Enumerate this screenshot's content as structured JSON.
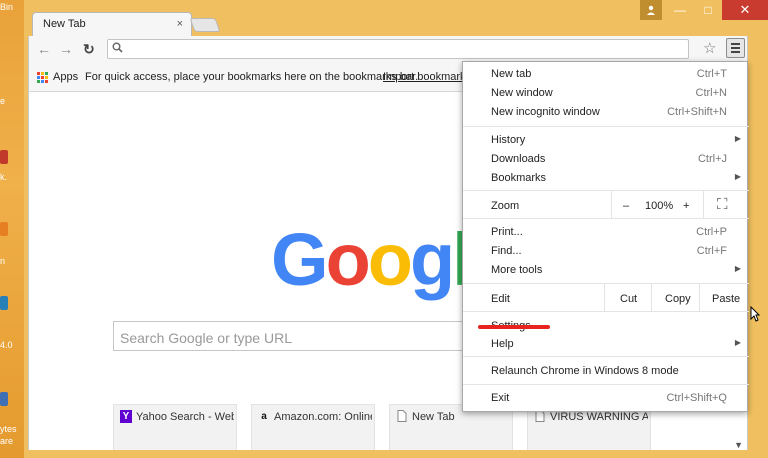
{
  "desktop": {
    "labels": [
      "Bin",
      "e",
      "k.",
      "n",
      "4.0",
      "ytes",
      "are"
    ]
  },
  "window": {
    "close_glyph": "✕",
    "maximize_glyph": "□",
    "minimize_glyph": "—"
  },
  "tab": {
    "title": "New Tab",
    "close_glyph": "×"
  },
  "toolbar": {
    "back_glyph": "←",
    "forward_glyph": "→",
    "reload_glyph": "↻",
    "search_icon": "search-icon",
    "star_glyph": "☆",
    "omnibox_value": ""
  },
  "bookmarks": {
    "apps_label": "Apps",
    "hint": "For quick access, place your bookmarks here on the bookmarks bar.",
    "import_link": "Import bookmarks"
  },
  "page": {
    "logo_letters": [
      "G",
      "o",
      "o",
      "g",
      "l",
      "e"
    ],
    "logo_colors": [
      "#4285f4",
      "#ea4335",
      "#fbbc05",
      "#4285f4",
      "#34a853",
      "#ea4335"
    ],
    "search_placeholder": "Search Google or type URL",
    "tiles": [
      {
        "icon": "Y",
        "title": "Yahoo Search - Web"
      },
      {
        "icon": "a",
        "title": "Amazon.com: Online"
      },
      {
        "icon": "doc",
        "title": "New Tab"
      },
      {
        "icon": "doc",
        "title": "VIRUS WARNING AL"
      }
    ]
  },
  "menu": {
    "new_tab": {
      "label": "New tab",
      "shortcut": "Ctrl+T"
    },
    "new_window": {
      "label": "New window",
      "shortcut": "Ctrl+N"
    },
    "new_incognito": {
      "label": "New incognito window",
      "shortcut": "Ctrl+Shift+N"
    },
    "history": {
      "label": "History"
    },
    "downloads": {
      "label": "Downloads",
      "shortcut": "Ctrl+J"
    },
    "bookmarks": {
      "label": "Bookmarks"
    },
    "zoom": {
      "label": "Zoom",
      "minus": "–",
      "value": "100%",
      "plus": "+"
    },
    "print": {
      "label": "Print...",
      "shortcut": "Ctrl+P"
    },
    "find": {
      "label": "Find...",
      "shortcut": "Ctrl+F"
    },
    "more_tools": {
      "label": "More tools"
    },
    "edit": {
      "label": "Edit",
      "cut": "Cut",
      "copy": "Copy",
      "paste": "Paste"
    },
    "settings": {
      "label": "Settings"
    },
    "help": {
      "label": "Help"
    },
    "relaunch": {
      "label": "Relaunch Chrome in Windows 8 mode"
    },
    "exit": {
      "label": "Exit",
      "shortcut": "Ctrl+Shift+Q"
    },
    "submenu_glyph": "▶",
    "fullscreen_glyph": "⛶"
  },
  "colors": {
    "highlight_underline": "#e8231f",
    "frame": "#f0c060"
  }
}
